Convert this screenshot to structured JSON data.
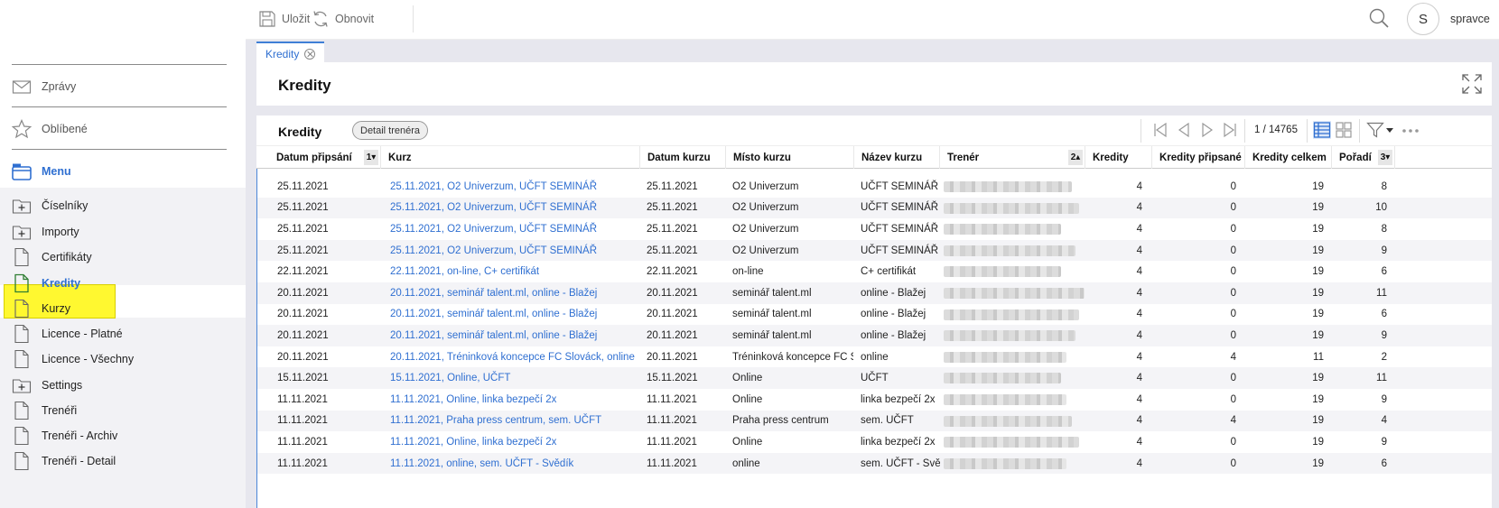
{
  "toolbar": {
    "save_label": "Uložit",
    "refresh_label": "Obnovit",
    "user_initial": "S",
    "username": "spravce"
  },
  "sidebar": {
    "top_items": [
      {
        "label": "Zprávy",
        "icon": "mail-icon"
      },
      {
        "label": "Oblíbené",
        "icon": "star-icon"
      },
      {
        "label": "Menu",
        "icon": "menu-icon"
      }
    ],
    "items": [
      {
        "label": "Číselníky",
        "icon": "folder-plus-icon"
      },
      {
        "label": "Importy",
        "icon": "folder-plus-icon"
      },
      {
        "label": "Certifikáty",
        "icon": "document-icon"
      },
      {
        "label": "Kredity",
        "icon": "document-icon",
        "active": true
      },
      {
        "label": "Kurzy",
        "icon": "document-icon"
      },
      {
        "label": "Licence - Platné",
        "icon": "document-icon"
      },
      {
        "label": "Licence - Všechny",
        "icon": "document-icon"
      },
      {
        "label": "Settings",
        "icon": "folder-plus-icon"
      },
      {
        "label": "Trenéři",
        "icon": "document-icon"
      },
      {
        "label": "Trenéři - Archiv",
        "icon": "document-icon"
      },
      {
        "label": "Trenéři - Detail",
        "icon": "document-icon"
      }
    ]
  },
  "tab": {
    "label": "Kredity"
  },
  "page": {
    "title": "Kredity"
  },
  "grid": {
    "title": "Kredity",
    "detail_button": "Detail trenéra",
    "pager": "1 / 14765",
    "columns": [
      {
        "label": "Datum připsání",
        "sort": "1▾"
      },
      {
        "label": "Kurz"
      },
      {
        "label": "Datum kurzu"
      },
      {
        "label": "Místo kurzu"
      },
      {
        "label": "Název kurzu"
      },
      {
        "label": "Trenér",
        "sort": "2▴"
      },
      {
        "label": "Kredity"
      },
      {
        "label": "Kredity připsané"
      },
      {
        "label": "Kredity celkem"
      },
      {
        "label": "Pořadí",
        "sort": "3▾"
      }
    ],
    "rows": [
      [
        "25.11.2021",
        "25.11.2021, O2 Univerzum, UČFT SEMINÁŘ",
        "25.11.2021",
        "O2 Univerzum",
        "UČFT SEMINÁŘ",
        "4",
        "0",
        "19",
        "8"
      ],
      [
        "25.11.2021",
        "25.11.2021, O2 Univerzum, UČFT SEMINÁŘ",
        "25.11.2021",
        "O2 Univerzum",
        "UČFT SEMINÁŘ",
        "4",
        "0",
        "19",
        "10"
      ],
      [
        "25.11.2021",
        "25.11.2021, O2 Univerzum, UČFT SEMINÁŘ",
        "25.11.2021",
        "O2 Univerzum",
        "UČFT SEMINÁŘ",
        "4",
        "0",
        "19",
        "8"
      ],
      [
        "25.11.2021",
        "25.11.2021, O2 Univerzum, UČFT SEMINÁŘ",
        "25.11.2021",
        "O2 Univerzum",
        "UČFT SEMINÁŘ",
        "4",
        "0",
        "19",
        "9"
      ],
      [
        "22.11.2021",
        "22.11.2021, on-line, C+ certifikát",
        "22.11.2021",
        "on-line",
        "C+ certifikát",
        "4",
        "0",
        "19",
        "6"
      ],
      [
        "20.11.2021",
        "20.11.2021, seminář talent.ml, online - Blažej",
        "20.11.2021",
        "seminář talent.ml",
        "online - Blažej",
        "4",
        "0",
        "19",
        "11"
      ],
      [
        "20.11.2021",
        "20.11.2021, seminář talent.ml, online - Blažej",
        "20.11.2021",
        "seminář talent.ml",
        "online - Blažej",
        "4",
        "0",
        "19",
        "6"
      ],
      [
        "20.11.2021",
        "20.11.2021, seminář talent.ml, online - Blažej",
        "20.11.2021",
        "seminář talent.ml",
        "online - Blažej",
        "4",
        "0",
        "19",
        "9"
      ],
      [
        "20.11.2021",
        "20.11.2021, Tréninková koncepce FC Slováck, online",
        "20.11.2021",
        "Tréninková koncepce FC S",
        "online",
        "4",
        "4",
        "11",
        "2"
      ],
      [
        "15.11.2021",
        "15.11.2021, Online, UČFT",
        "15.11.2021",
        "Online",
        "UČFT",
        "4",
        "0",
        "19",
        "11"
      ],
      [
        "11.11.2021",
        "11.11.2021, Online, linka bezpečí 2x",
        "11.11.2021",
        "Online",
        "linka bezpečí 2x",
        "4",
        "0",
        "19",
        "9"
      ],
      [
        "11.11.2021",
        "11.11.2021, Praha press centrum, sem. UČFT",
        "11.11.2021",
        "Praha press centrum",
        "sem. UČFT",
        "4",
        "4",
        "19",
        "4"
      ],
      [
        "11.11.2021",
        "11.11.2021, Online, linka bezpečí 2x",
        "11.11.2021",
        "Online",
        "linka bezpečí 2x",
        "4",
        "0",
        "19",
        "9"
      ],
      [
        "11.11.2021",
        "11.11.2021, online, sem. UČFT - Svědík",
        "11.11.2021",
        "online",
        "sem. UČFT - Svě",
        "4",
        "0",
        "19",
        "6"
      ]
    ]
  }
}
